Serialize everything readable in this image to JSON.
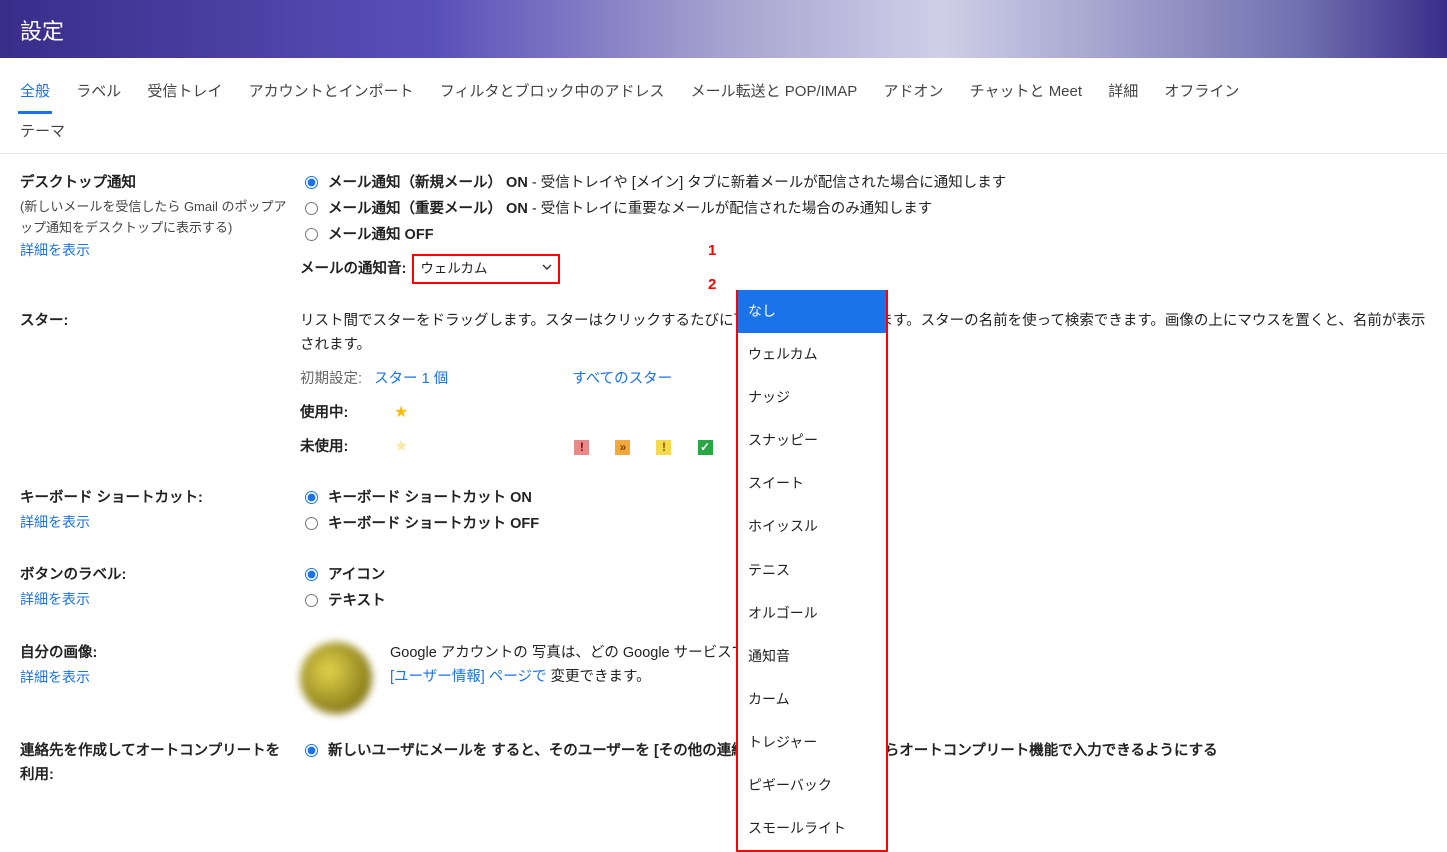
{
  "page_title": "設定",
  "tabs": {
    "general": "全般",
    "labels": "ラベル",
    "inbox": "受信トレイ",
    "accounts": "アカウントとインポート",
    "filters": "フィルタとブロック中のアドレス",
    "forwarding": "メール転送と POP/IMAP",
    "addons": "アドオン",
    "chat": "チャットと Meet",
    "advanced": "詳細",
    "offline": "オフライン",
    "themes": "テーマ"
  },
  "desktop_notif": {
    "section_title": "デスクトップ通知",
    "section_sub": "(新しいメールを受信したら Gmail のポップアップ通知をデスクトップに表示する)",
    "learn_more": "詳細を表示",
    "opt_new_bold": "メール通知（新規メール） ON",
    "opt_new_desc": " - 受信トレイや [メイン] タブに新着メールが配信された場合に通知します",
    "opt_important_bold": "メール通知（重要メール） ON",
    "opt_important_desc": " - 受信トレイに重要なメールが配信された場合のみ通知します",
    "opt_off_bold": "メール通知 OFF",
    "sound_label": "メールの通知音:",
    "sound_selected": "ウェルカム",
    "sound_options": [
      "なし",
      "ウェルカム",
      "ナッジ",
      "スナッピー",
      "スイート",
      "ホイッスル",
      "テニス",
      "オルゴール",
      "通知音",
      "カーム",
      "トレジャー",
      "ピギーバック",
      "スモールライト"
    ]
  },
  "annotations": {
    "one": "1",
    "two": "2"
  },
  "stars": {
    "section_title": "スター:",
    "description": "リスト間でスターをドラッグします。スターはクリックするたびに下記の順で切り替わります。スターの名前を使って検索できます。画像の上にマウスを置くと、名前が表示されます。",
    "default_label": "初期設定:",
    "link_one_star": "スター 1 個",
    "link_all_stars": "すべてのスター",
    "in_use_label": "使用中:",
    "not_used_label": "未使用:"
  },
  "shortcuts": {
    "section_title": "キーボード ショートカット:",
    "learn_more": "詳細を表示",
    "opt_on": "キーボード ショートカット ON",
    "opt_off": "キーボード ショートカット OFF"
  },
  "button_labels": {
    "section_title": "ボタンのラベル:",
    "learn_more": "詳細を表示",
    "opt_icons": "アイコン",
    "opt_text": "テキスト"
  },
  "my_picture": {
    "section_title": "自分の画像:",
    "learn_more": "詳細を表示",
    "line1_prefix": "Google アカウントの",
    "line1_suffix": "写真は、どの Google サービスでも表示されます。",
    "line2_prefix": "[ユーザー情報] ページで",
    "line2_suffix": "変更できます。"
  },
  "autocomplete": {
    "section_title": "連絡先を作成してオートコンプリートを利用:",
    "opt_on_part1": "新しいユーザにメールを",
    "opt_on_part2": "すると、そのユーザーを [その他の連絡先] に追加して次回からオートコンプリート機能で入力できるようにする"
  }
}
